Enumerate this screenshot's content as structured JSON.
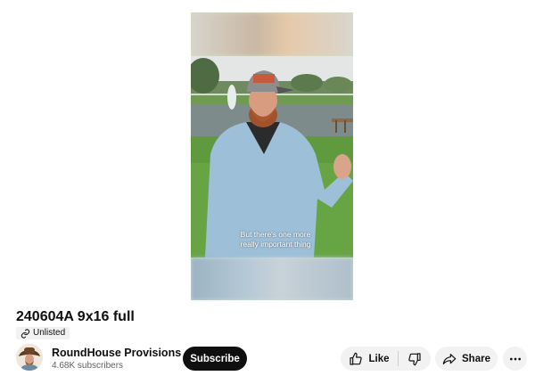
{
  "video": {
    "caption_line1": "But there's one more",
    "caption_line2": "really important thing"
  },
  "title": "240604A 9x16 full",
  "badge": {
    "label": "Unlisted",
    "icon": "link-icon"
  },
  "channel": {
    "name": "RoundHouse Provisions",
    "subscribers": "4.68K subscribers"
  },
  "actions": {
    "subscribe_label": "Subscribe",
    "like_label": "Like",
    "share_label": "Share",
    "icons": [
      "thumbs-up-icon",
      "thumbs-down-icon",
      "share-arrow-icon",
      "more-horizontal-icon"
    ]
  },
  "colors": {
    "subscribe_bg": "#0f0f0f",
    "pill_bg": "#f2f2f2",
    "secondary_text": "#606060"
  }
}
